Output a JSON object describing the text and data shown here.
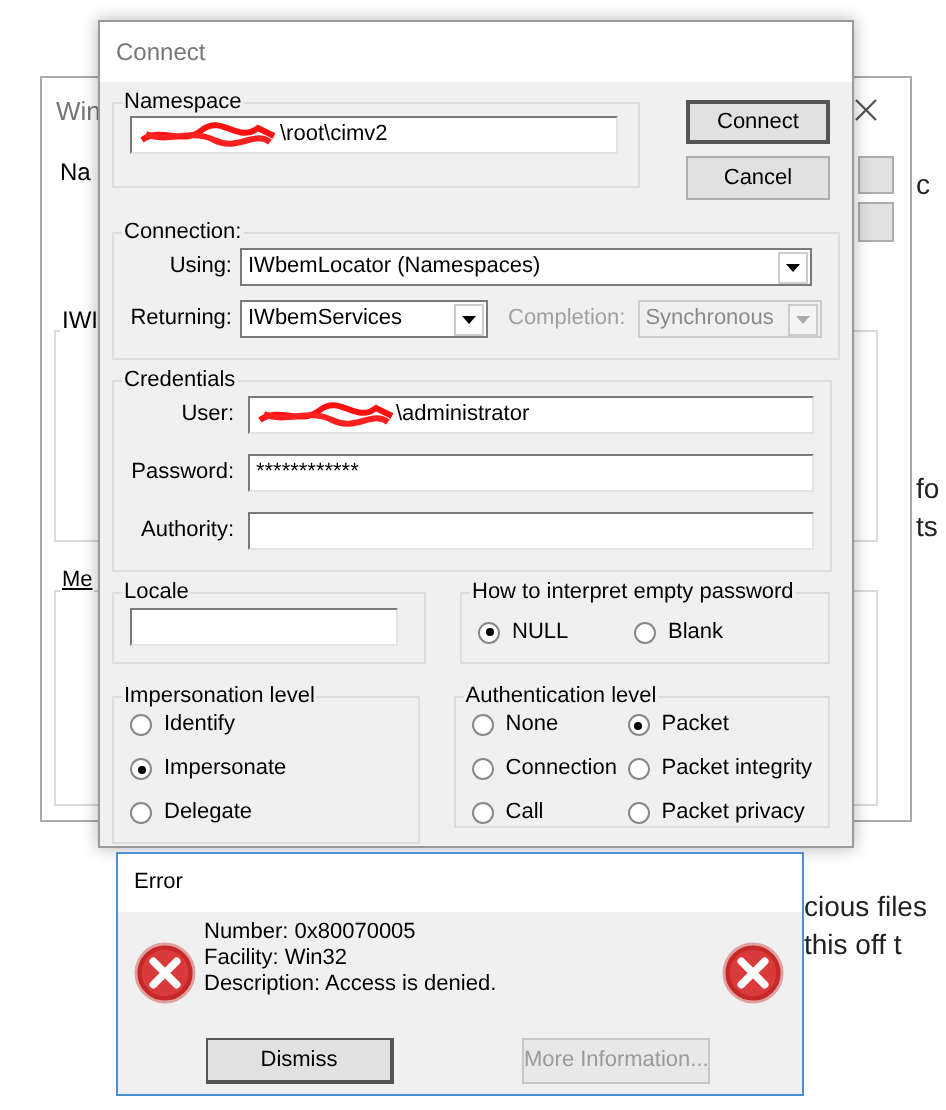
{
  "background_window": {
    "title": "Win",
    "name_label": "Na",
    "group_1": "IWI",
    "group_2": "Me"
  },
  "background_page": {
    "fragments": [
      "c",
      "fo",
      "ts"
    ],
    "lines": [
      "cious files",
      "this off t"
    ]
  },
  "connect_dialog": {
    "title": "Connect",
    "namespace": {
      "label": "Namespace",
      "value": "\\root\\cimv2"
    },
    "buttons": [
      {
        "label": "Connect",
        "default": true
      },
      {
        "label": "Cancel",
        "default": false
      }
    ],
    "connection": {
      "label": "Connection:",
      "using": {
        "label": "Using:",
        "value": "IWbemLocator (Namespaces)"
      },
      "returning": {
        "label": "Returning:",
        "value": "IWbemServices"
      },
      "completion": {
        "label": "Completion:",
        "value": "Synchronous",
        "disabled": true
      }
    },
    "credentials": {
      "label": "Credentials",
      "user": {
        "label": "User:",
        "value": "\\administrator"
      },
      "password": {
        "label": "Password:",
        "value": "************"
      },
      "authority": {
        "label": "Authority:"
      }
    },
    "locale": {
      "label": "Locale"
    },
    "empty_password": {
      "label": "How to interpret empty password",
      "options": [
        {
          "label": "NULL",
          "selected": true
        },
        {
          "label": "Blank",
          "selected": false
        }
      ]
    },
    "impersonation": {
      "label": "Impersonation level",
      "options": [
        {
          "label": "Identify",
          "selected": false
        },
        {
          "label": "Impersonate",
          "selected": true
        },
        {
          "label": "Delegate",
          "selected": false
        }
      ]
    },
    "authentication": {
      "label": "Authentication level",
      "options": [
        {
          "label": "None",
          "selected": false
        },
        {
          "label": "Packet",
          "selected": true
        },
        {
          "label": "Connection",
          "selected": false
        },
        {
          "label": "Packet integrity",
          "selected": false
        },
        {
          "label": "Call",
          "selected": false
        },
        {
          "label": "Packet privacy",
          "selected": false
        }
      ]
    }
  },
  "error_dialog": {
    "title": "Error",
    "lines": [
      "Number: 0x80070005",
      "Facility: Win32",
      "Description: Access is denied."
    ],
    "buttons": [
      {
        "label": "Dismiss",
        "disabled": false
      },
      {
        "label": "More Information...",
        "disabled": true
      }
    ]
  }
}
